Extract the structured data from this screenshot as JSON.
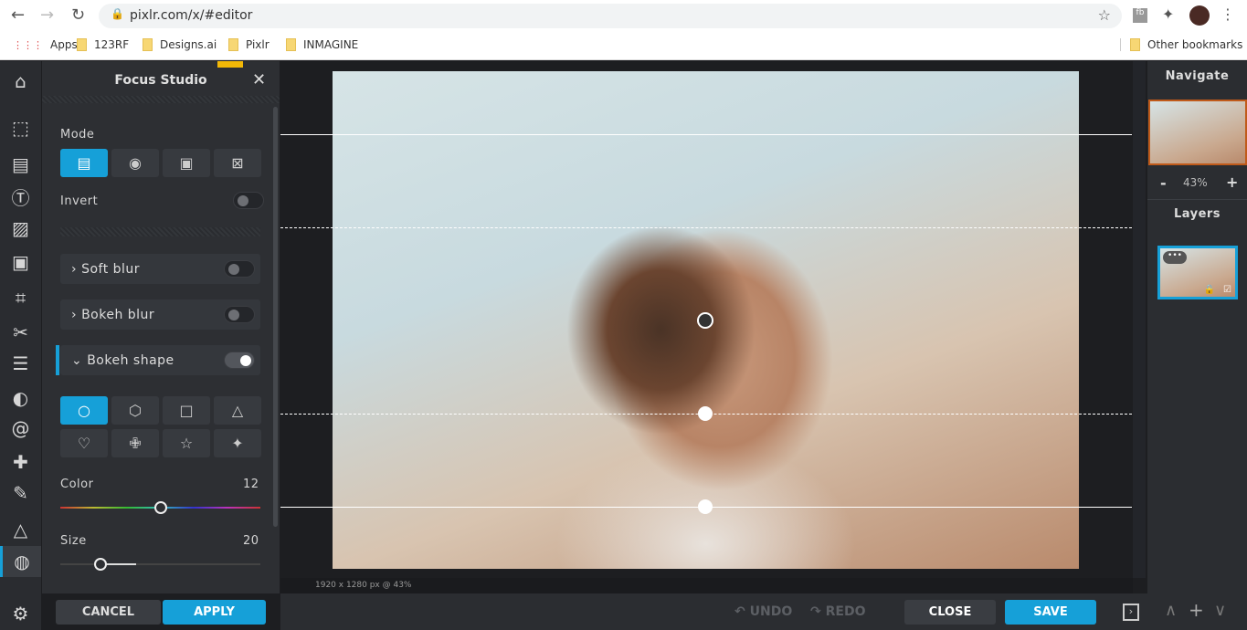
{
  "browser": {
    "url": "pixlr.com/x/#editor",
    "bookmarks": [
      {
        "label": "Apps"
      },
      {
        "label": "123RF"
      },
      {
        "label": "Designs.ai"
      },
      {
        "label": "Pixlr"
      },
      {
        "label": "INMAGINE"
      }
    ],
    "other_bookmarks": "Other bookmarks"
  },
  "rail": {
    "tools": [
      "home",
      "arrange",
      "layout",
      "text",
      "pattern",
      "image",
      "crop",
      "cutout",
      "adjust",
      "filter",
      "liquify",
      "heal",
      "brush",
      "draw",
      "focus"
    ],
    "active": "focus",
    "settings": "settings"
  },
  "panel": {
    "title": "Focus Studio",
    "mode_label": "Mode",
    "modes": [
      "linear",
      "radial",
      "gradient",
      "none"
    ],
    "invert_label": "Invert",
    "invert_on": false,
    "sections": [
      {
        "label": "Soft blur",
        "expanded": false,
        "on": false
      },
      {
        "label": "Bokeh blur",
        "expanded": false,
        "on": false
      },
      {
        "label": "Bokeh shape",
        "expanded": true,
        "on": true
      }
    ],
    "shapes": [
      "circle",
      "hexagon",
      "square",
      "triangle",
      "heart",
      "cross",
      "star",
      "sparkle"
    ],
    "color_label": "Color",
    "color_value": "12",
    "color_fraction": 0.5,
    "size_label": "Size",
    "size_value": "20",
    "size_fraction": 0.2,
    "cancel": "CANCEL",
    "apply": "APPLY"
  },
  "canvas": {
    "status": "1920 x 1280 px @ 43%"
  },
  "right": {
    "navigate": "Navigate",
    "zoom": "43%",
    "minus": "-",
    "plus": "+",
    "layers": "Layers"
  },
  "bottom": {
    "undo": "UNDO",
    "redo": "REDO",
    "close": "CLOSE",
    "save": "SAVE"
  },
  "colors": {
    "accent": "#16a0d8"
  }
}
